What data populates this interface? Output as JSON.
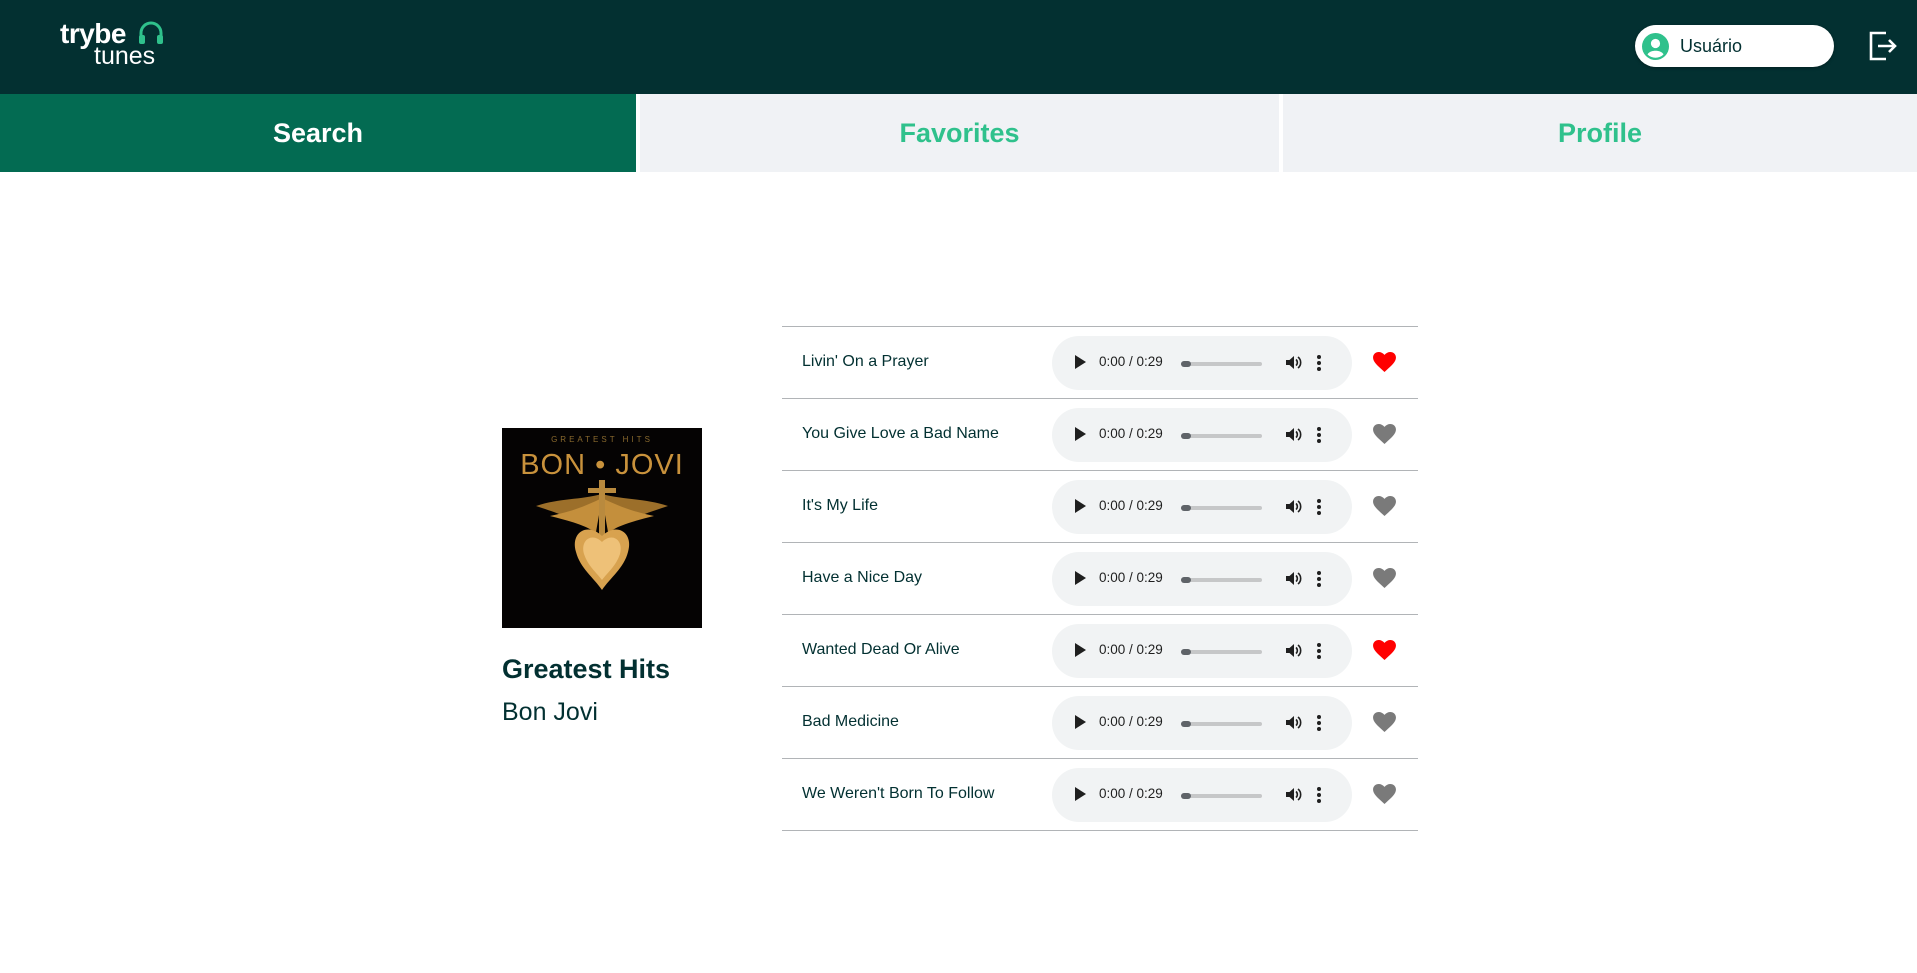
{
  "header": {
    "logo": {
      "line1": "trybe",
      "line2": "tunes",
      "icon": "headphones-icon"
    },
    "user": {
      "name": "Usuário",
      "icon": "user-avatar-icon"
    },
    "logout_icon": "logout-icon"
  },
  "tabs": [
    {
      "label": "Search",
      "active": true
    },
    {
      "label": "Favorites",
      "active": false
    },
    {
      "label": "Profile",
      "active": false
    }
  ],
  "album": {
    "title": "Greatest Hits",
    "artist": "Bon Jovi",
    "cover": {
      "top_text": "GREATEST HITS",
      "band_text": "BON • JOVI"
    }
  },
  "tracks": [
    {
      "name": "Livin' On a Prayer",
      "time": "0:00 / 0:29",
      "progress": 0,
      "favorite": true
    },
    {
      "name": "You Give Love a Bad Name",
      "time": "0:00 / 0:29",
      "progress": 0,
      "favorite": false
    },
    {
      "name": "It's My Life",
      "time": "0:00 / 0:29",
      "progress": 0,
      "favorite": false
    },
    {
      "name": "Have a Nice Day",
      "time": "0:00 / 0:29",
      "progress": 0,
      "favorite": false
    },
    {
      "name": "Wanted Dead Or Alive",
      "time": "0:00 / 0:29",
      "progress": 0,
      "favorite": true
    },
    {
      "name": "Bad Medicine",
      "time": "0:00 / 0:29",
      "progress": 0,
      "favorite": false
    },
    {
      "name": "We Weren't Born To Follow",
      "time": "0:00 / 0:29",
      "progress": 0,
      "favorite": false
    }
  ],
  "colors": {
    "header_bg": "#033031",
    "accent_green": "#2fc18c",
    "active_tab_bg": "#036b52",
    "tab_bg": "#f0f2f5",
    "heart_favorite": "#ff0000",
    "heart_default": "#7a7a7a"
  }
}
